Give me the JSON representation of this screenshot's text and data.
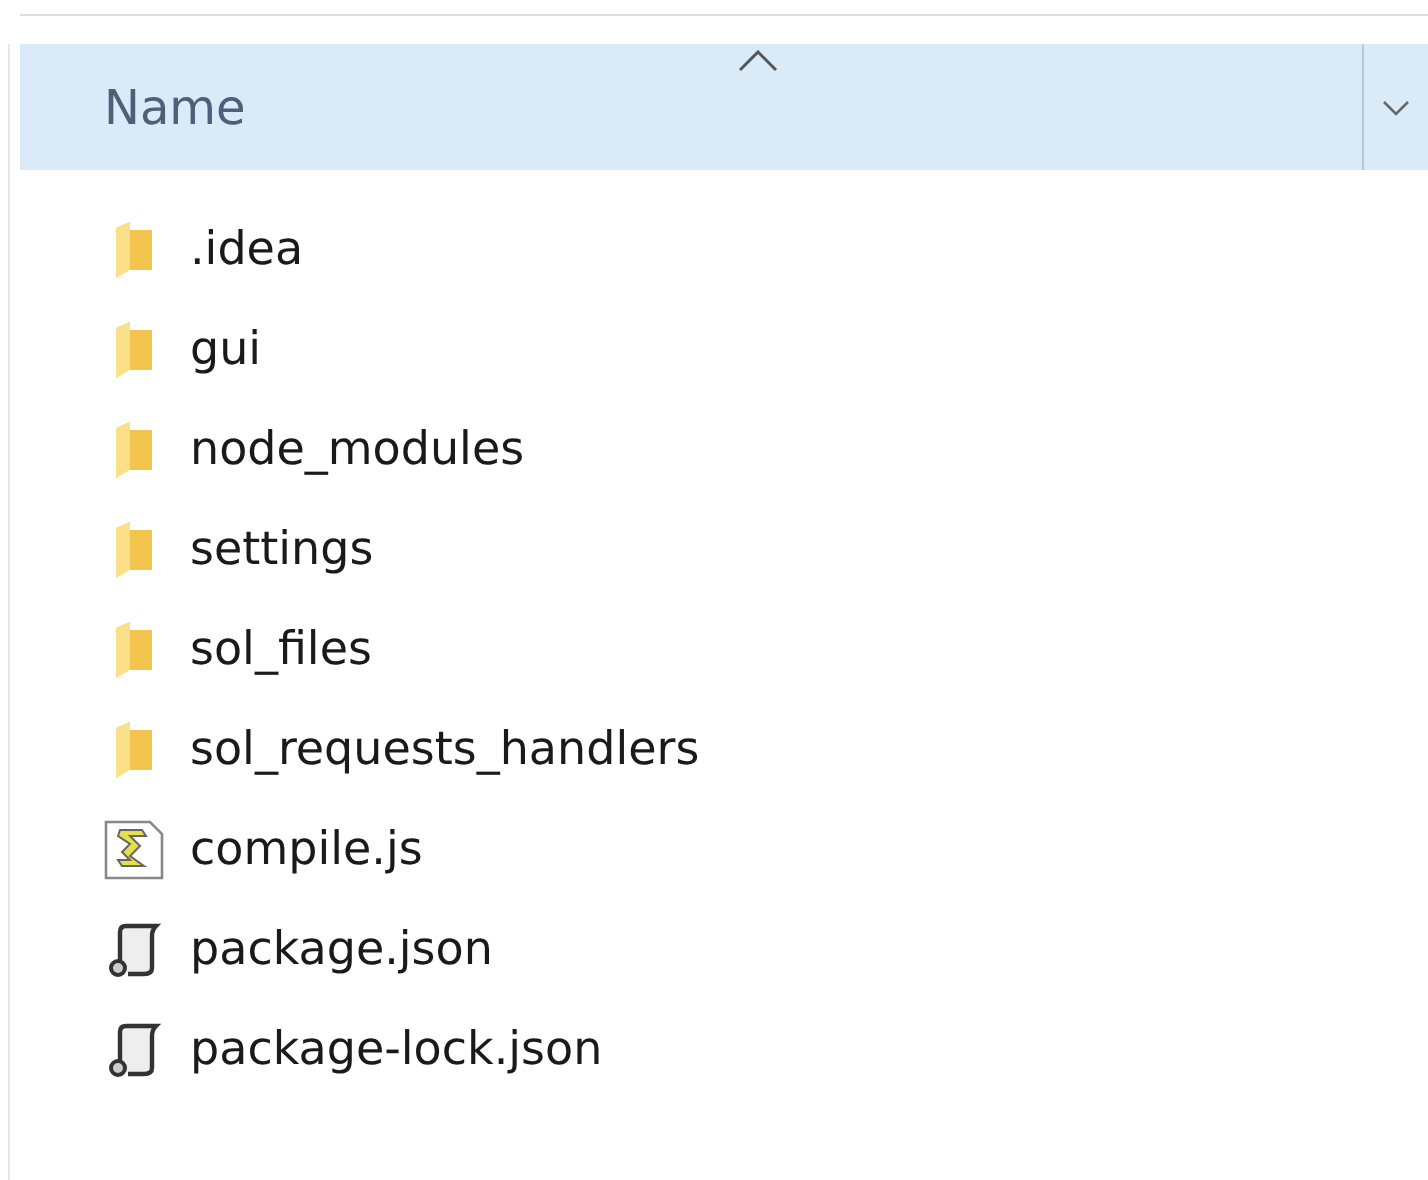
{
  "column_header": {
    "label": "Name",
    "sorted_ascending": true,
    "hovered": true
  },
  "files": [
    {
      "name": ".idea",
      "kind": "folder"
    },
    {
      "name": "gui",
      "kind": "folder"
    },
    {
      "name": "node_modules",
      "kind": "folder"
    },
    {
      "name": "settings",
      "kind": "folder"
    },
    {
      "name": "sol_files",
      "kind": "folder"
    },
    {
      "name": "sol_requests_handlers",
      "kind": "folder"
    },
    {
      "name": "compile.js",
      "kind": "script"
    },
    {
      "name": "package.json",
      "kind": "json"
    },
    {
      "name": "package-lock.json",
      "kind": "json"
    }
  ]
}
